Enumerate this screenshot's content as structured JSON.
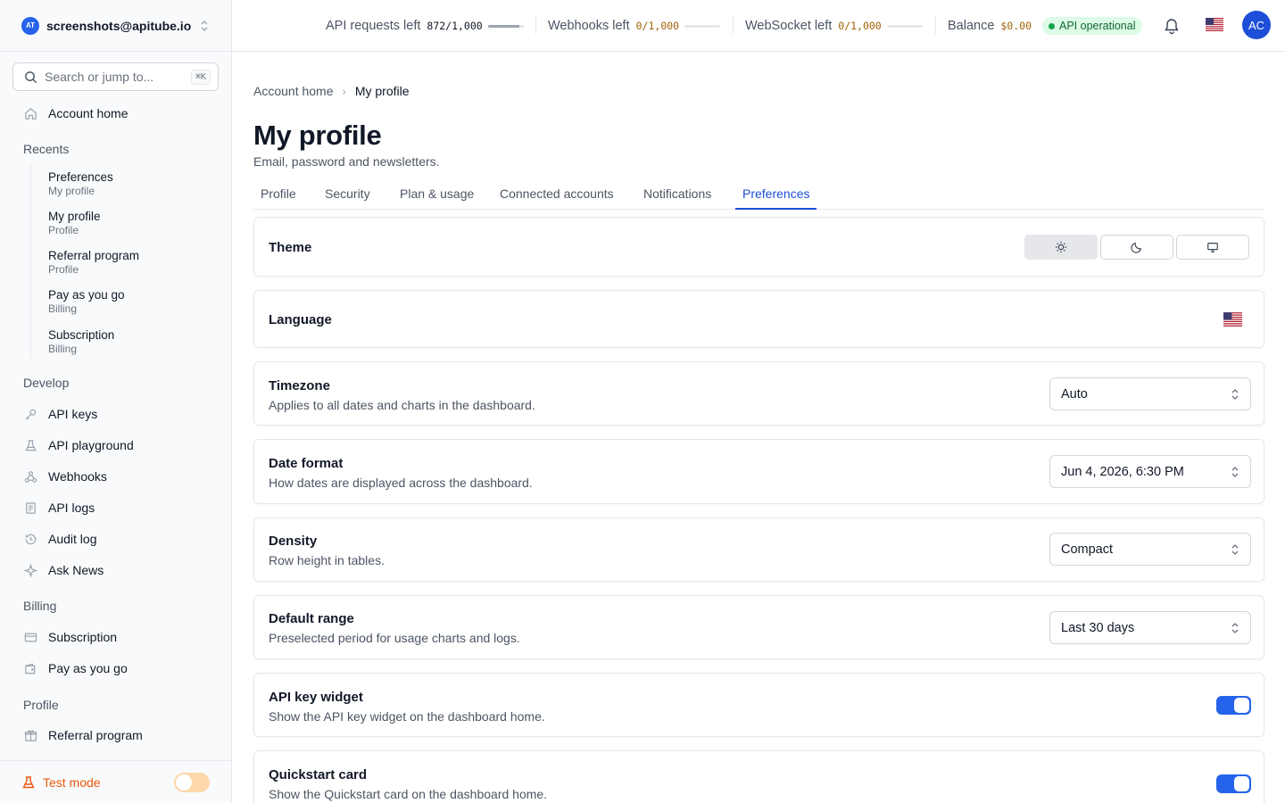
{
  "account": {
    "email": "screenshots@apitube.io",
    "logo_text": "AT"
  },
  "search": {
    "placeholder": "Search or jump to...",
    "shortcut": "⌘K"
  },
  "sidebar": {
    "home": "Account home",
    "recents_label": "Recents",
    "recents": [
      {
        "title": "Preferences",
        "sub": "My profile"
      },
      {
        "title": "My profile",
        "sub": "Profile"
      },
      {
        "title": "Referral program",
        "sub": "Profile"
      },
      {
        "title": "Pay as you go",
        "sub": "Billing"
      },
      {
        "title": "Subscription",
        "sub": "Billing"
      }
    ],
    "develop_label": "Develop",
    "develop": [
      {
        "label": "API keys",
        "icon": "key-icon"
      },
      {
        "label": "API playground",
        "icon": "flask-icon"
      },
      {
        "label": "Webhooks",
        "icon": "webhook-icon"
      },
      {
        "label": "API logs",
        "icon": "logs-icon"
      },
      {
        "label": "Audit log",
        "icon": "history-icon"
      },
      {
        "label": "Ask News",
        "icon": "sparkle-icon"
      }
    ],
    "billing_label": "Billing",
    "billing": [
      {
        "label": "Subscription",
        "icon": "card-icon"
      },
      {
        "label": "Pay as you go",
        "icon": "wallet-icon"
      }
    ],
    "profile_label": "Profile",
    "profile": [
      {
        "label": "Referral program",
        "icon": "gift-icon"
      }
    ],
    "test_mode": {
      "label": "Test mode",
      "enabled": false
    }
  },
  "header": {
    "api_requests": {
      "label": "API requests left",
      "value": "872/1,000",
      "fraction": 0.872
    },
    "webhooks": {
      "label": "Webhooks left",
      "value": "0/1,000",
      "fraction": 0
    },
    "websocket": {
      "label": "WebSocket left",
      "value": "0/1,000",
      "fraction": 0
    },
    "balance": {
      "label": "Balance",
      "value": "$0.00"
    },
    "status": "API operational",
    "avatar": "AC"
  },
  "breadcrumb": {
    "home": "Account home",
    "current": "My profile"
  },
  "page": {
    "title": "My profile",
    "subtitle": "Email, password and newsletters."
  },
  "tabs": [
    {
      "label": "Profile"
    },
    {
      "label": "Security"
    },
    {
      "label": "Plan & usage"
    },
    {
      "label": "Connected accounts"
    },
    {
      "label": "Notifications"
    },
    {
      "label": "Preferences",
      "active": true
    }
  ],
  "settings": {
    "theme": {
      "title": "Theme",
      "selected": "light"
    },
    "language": {
      "title": "Language",
      "value_icon": "us-flag-icon"
    },
    "timezone": {
      "title": "Timezone",
      "desc": "Applies to all dates and charts in the dashboard.",
      "value": "Auto"
    },
    "date_format": {
      "title": "Date format",
      "desc": "How dates are displayed across the dashboard.",
      "value": "Jun 4, 2026, 6:30 PM"
    },
    "density": {
      "title": "Density",
      "desc": "Row height in tables.",
      "value": "Compact"
    },
    "default_range": {
      "title": "Default range",
      "desc": "Preselected period for usage charts and logs.",
      "value": "Last 30 days"
    },
    "api_key_widget": {
      "title": "API key widget",
      "desc": "Show the API key widget on the dashboard home.",
      "enabled": true
    },
    "quickstart_card": {
      "title": "Quickstart card",
      "desc": "Show the Quickstart card on the dashboard home.",
      "enabled": true
    }
  },
  "colors": {
    "accent": "#1d4ed8",
    "switch_on": "#2563eb",
    "status_bg": "#dcfce7",
    "warn": "#ea580c"
  }
}
